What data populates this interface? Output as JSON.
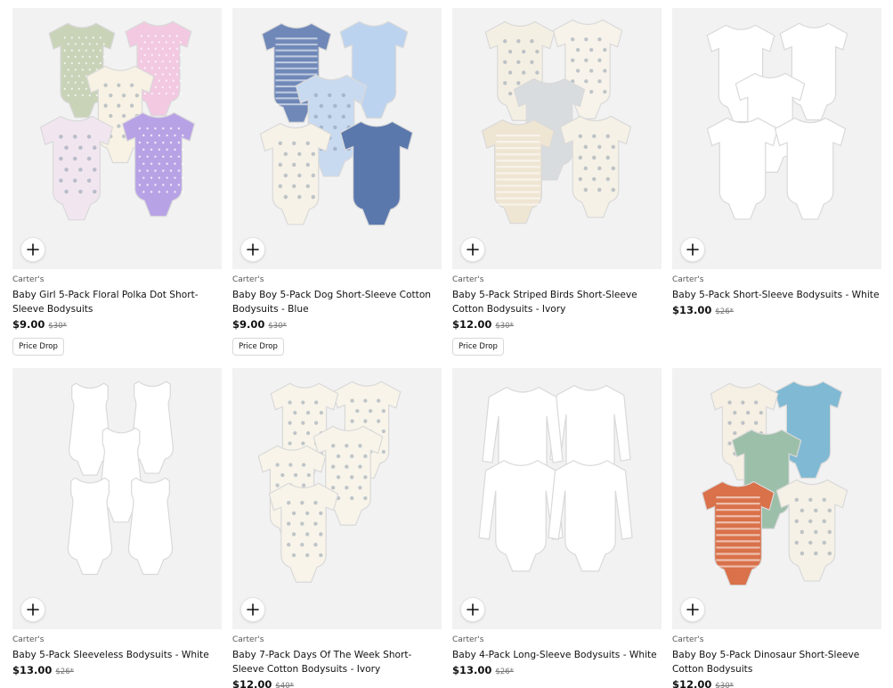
{
  "colors": {
    "tile_bg": "#f2f2f2",
    "price": "#111111",
    "was_price": "#777777",
    "badge_border": "#d8d8d8"
  },
  "products": [
    {
      "brand": "Carter's",
      "name": "Baby Girl 5-Pack Floral Polka Dot Short-Sleeve Bodysuits",
      "price": "$9.00",
      "was": "$30*",
      "badge": "Price Drop",
      "garment_colors": [
        "#c9d3b8",
        "#f3c9e2",
        "#f7f2e4",
        "#f1e6ef",
        "#b8a2e6"
      ],
      "add_icon": "plus-icon"
    },
    {
      "brand": "Carter's",
      "name": "Baby Boy 5-Pack Dog Short-Sleeve Cotton Bodysuits - Blue",
      "price": "$9.00",
      "was": "$30*",
      "badge": "Price Drop",
      "garment_colors": [
        "#6f88b8",
        "#bcd3ef",
        "#c8daf0",
        "#f7f2e8",
        "#5b78ad"
      ],
      "add_icon": "plus-icon"
    },
    {
      "brand": "Carter's",
      "name": "Baby 5-Pack Striped Birds Short-Sleeve Cotton Bodysuits - Ivory",
      "price": "$12.00",
      "was": "$30*",
      "badge": "Price Drop",
      "garment_colors": [
        "#f4efe3",
        "#f7f3ea",
        "#d9dcdf",
        "#efe5d3",
        "#f6f1e6"
      ],
      "add_icon": "plus-icon"
    },
    {
      "brand": "Carter's",
      "name": "Baby 5-Pack Short-Sleeve Bodysuits - White",
      "price": "$13.00",
      "was": "$26*",
      "badge": "",
      "garment_colors": [
        "#ffffff",
        "#ffffff",
        "#ffffff",
        "#ffffff",
        "#ffffff"
      ],
      "add_icon": "plus-icon"
    },
    {
      "brand": "Carter's",
      "name": "Baby 5-Pack Sleeveless Bodysuits - White",
      "price": "$13.00",
      "was": "$26*",
      "badge": "",
      "garment_colors": [
        "#ffffff",
        "#ffffff",
        "#ffffff",
        "#ffffff",
        "#ffffff"
      ],
      "add_icon": "plus-icon"
    },
    {
      "brand": "Carter's",
      "name": "Baby 7-Pack Days Of The Week Short-Sleeve Cotton Bodysuits - Ivory",
      "price": "$12.00",
      "was": "$40*",
      "badge": "",
      "garment_colors": [
        "#f8f4ea",
        "#f8f4ea",
        "#f8f4ea",
        "#f8f4ea",
        "#f8f4ea"
      ],
      "add_icon": "plus-icon"
    },
    {
      "brand": "Carter's",
      "name": "Baby 4-Pack Long-Sleeve Bodysuits - White",
      "price": "$13.00",
      "was": "$26*",
      "badge": "",
      "garment_colors": [
        "#ffffff",
        "#ffffff",
        "#ffffff",
        "#ffffff",
        "#ffffff"
      ],
      "add_icon": "plus-icon"
    },
    {
      "brand": "Carter's",
      "name": "Baby Boy 5-Pack Dinosaur Short-Sleeve Cotton Bodysuits",
      "price": "$12.00",
      "was": "$30*",
      "badge": "",
      "garment_colors": [
        "#f5efe4",
        "#7fb9d3",
        "#9cbfa9",
        "#d9714a",
        "#f6f1e6"
      ],
      "add_icon": "plus-icon"
    }
  ]
}
